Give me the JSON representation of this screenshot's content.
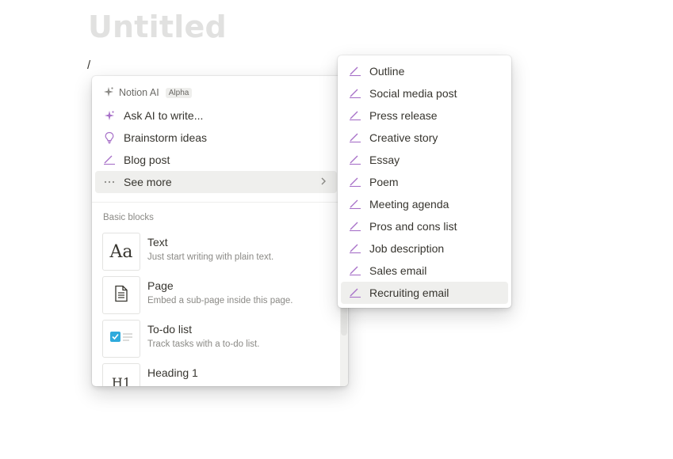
{
  "page": {
    "title": "Untitled",
    "slash": "/"
  },
  "menu": {
    "ai_header": {
      "label": "Notion AI",
      "badge": "Alpha",
      "icon": "sparkle-icon"
    },
    "ai_items": [
      {
        "label": "Ask AI to write...",
        "icon": "sparkle-icon"
      },
      {
        "label": "Brainstorm ideas",
        "icon": "lightbulb-icon"
      },
      {
        "label": "Blog post",
        "icon": "pen-icon"
      },
      {
        "label": "See more",
        "icon": "ellipsis-icon",
        "highlighted": true,
        "has_submenu": true
      }
    ],
    "section_title": "Basic blocks",
    "blocks": [
      {
        "label": "Text",
        "description": "Just start writing with plain text.",
        "thumb": "Aa"
      },
      {
        "label": "Page",
        "description": "Embed a sub-page inside this page.",
        "thumb": "page-icon"
      },
      {
        "label": "To-do list",
        "description": "Track tasks with a to-do list.",
        "thumb": "checkbox-icon"
      },
      {
        "label": "Heading 1",
        "description": "",
        "thumb": "H1"
      }
    ]
  },
  "submenu": {
    "items": [
      {
        "label": "Outline"
      },
      {
        "label": "Social media post"
      },
      {
        "label": "Press release"
      },
      {
        "label": "Creative story"
      },
      {
        "label": "Essay"
      },
      {
        "label": "Poem"
      },
      {
        "label": "Meeting agenda"
      },
      {
        "label": "Pros and cons list"
      },
      {
        "label": "Job description"
      },
      {
        "label": "Sales email"
      },
      {
        "label": "Recruiting email",
        "highlighted": true
      }
    ],
    "icon": "pen-icon"
  },
  "colors": {
    "ai_purple": "#a770c8",
    "text": "#37352f",
    "muted": "#8b8a86",
    "hover": "#efefed",
    "checkbox": "#2eaadc"
  }
}
